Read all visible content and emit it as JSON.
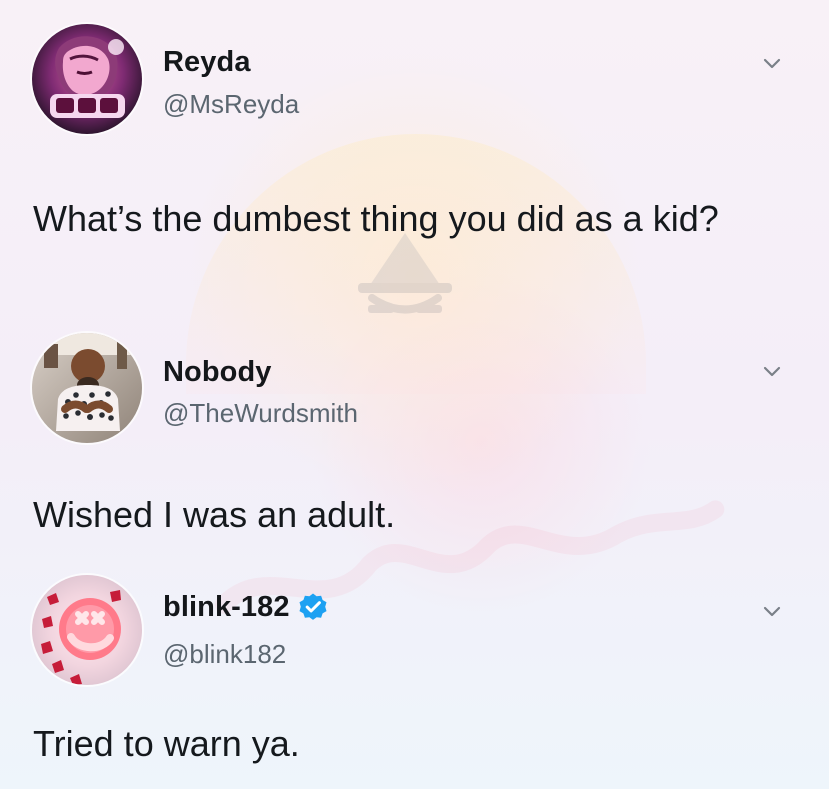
{
  "theme": {
    "text": "#15191d",
    "muted": "#5b6670",
    "verified": "#1da1f2"
  },
  "tweets": [
    {
      "display_name": "Reyda",
      "handle": "@MsReyda",
      "text": "What’s the dumbest thing you did as a kid?",
      "avatar_icon": "avatar-reyda-icon",
      "chevron_icon": "chevron-down-icon",
      "verified": false
    },
    {
      "display_name": "Nobody",
      "handle": "@TheWurdsmith",
      "text": "Wished I was an adult.",
      "avatar_icon": "avatar-nobody-icon",
      "chevron_icon": "chevron-down-icon",
      "verified": false
    },
    {
      "display_name": "blink-182",
      "handle": "@blink182",
      "text": "Tried to warn ya.",
      "avatar_icon": "avatar-blink182-icon",
      "chevron_icon": "chevron-down-icon",
      "verified": true,
      "verified_icon": "verified-badge-icon"
    }
  ]
}
